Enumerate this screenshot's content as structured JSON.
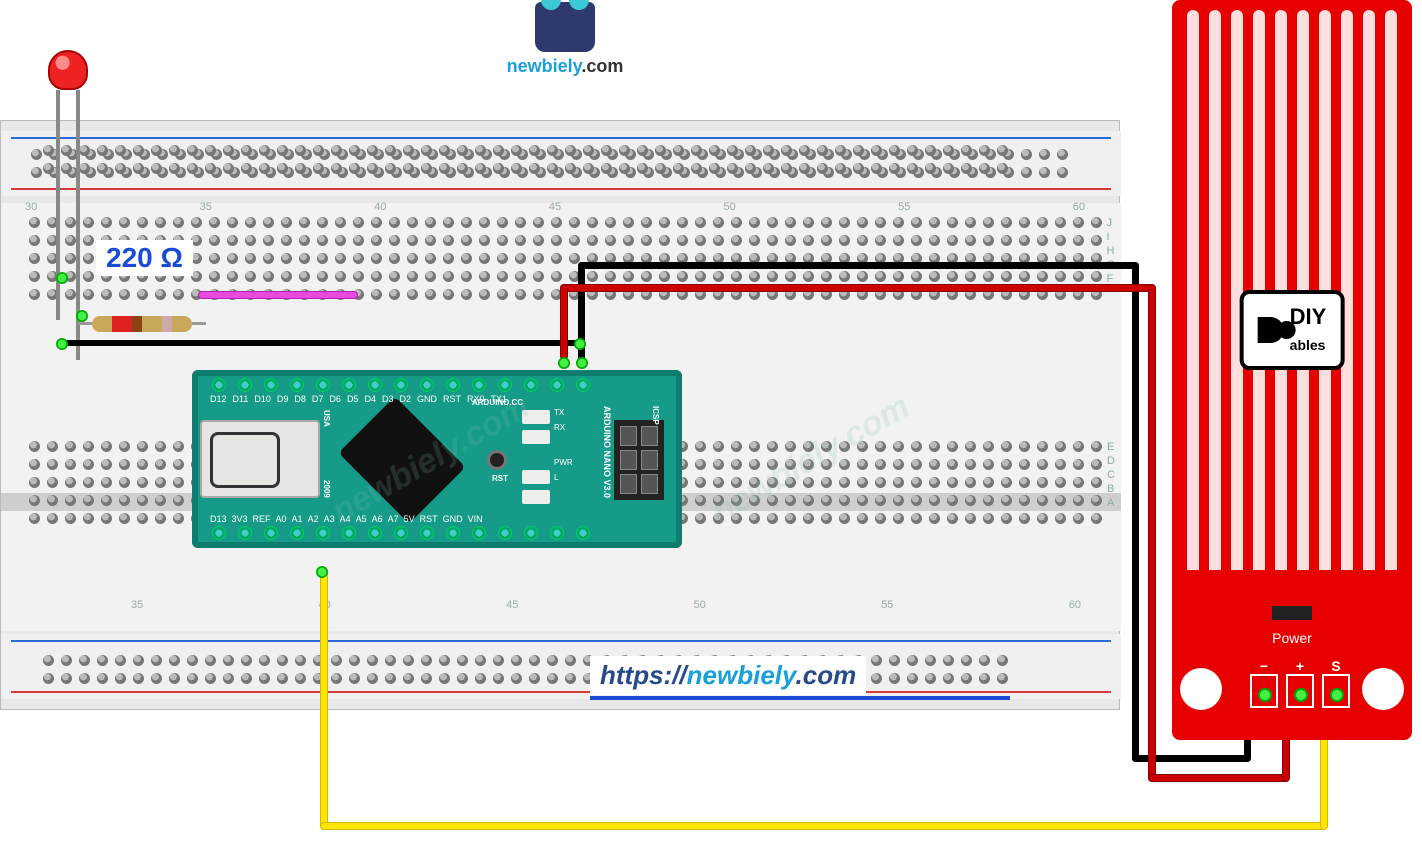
{
  "logo": {
    "text_main": "newbiely",
    "text_tld": ".com"
  },
  "resistor": {
    "label": "220 Ω"
  },
  "link": {
    "prefix": "https://",
    "host": "newbiely",
    "suffix": ".com"
  },
  "breadboard": {
    "col_numbers_top": [
      "30",
      "35",
      "40",
      "45",
      "50",
      "55",
      "60"
    ],
    "col_numbers_mid": [
      "35",
      "40",
      "45",
      "50",
      "55",
      "60"
    ],
    "row_letters_top": [
      "J",
      "I",
      "H",
      "G",
      "F"
    ],
    "row_letters_bot": [
      "E",
      "D",
      "C",
      "B",
      "A"
    ]
  },
  "arduino": {
    "model": "ARDUINO NANO V3.0",
    "cc_label": "ARDUINO.CC",
    "usa_label": "USA",
    "year": "2009",
    "icsp": "ICSP",
    "reset_btn": "RST",
    "top_pins": [
      "D12",
      "D11",
      "D10",
      "D9",
      "D8",
      "D7",
      "D6",
      "D5",
      "D4",
      "D3",
      "D2",
      "GND",
      "RST",
      "RX0",
      "TX1"
    ],
    "bottom_pins": [
      "D13",
      "3V3",
      "REF",
      "A0",
      "A1",
      "A2",
      "A3",
      "A4",
      "A5",
      "A6",
      "A7",
      "5V",
      "RST",
      "GND",
      "VIN"
    ],
    "internal_leds": [
      "TX",
      "RX",
      "PWR",
      "L"
    ]
  },
  "sensor": {
    "brand_text": "DIY",
    "brand_sub": "ables",
    "power_text": "Power",
    "pads": [
      "−",
      "+",
      "S"
    ]
  },
  "components": {
    "led": {
      "color": "red"
    },
    "resistor_value_ohms": 220,
    "jumper_colors": [
      "pink",
      "black",
      "red",
      "yellow"
    ]
  },
  "wire_connections": [
    {
      "color": "black",
      "from": "led-cathode-row",
      "to": "nano-GND-top"
    },
    {
      "color": "pink",
      "from": "resistor-right",
      "to": "nano-D2"
    },
    {
      "color": "black",
      "from": "nano-RX0/TX1-row",
      "to": "sensor-minus"
    },
    {
      "color": "red",
      "from": "nano-adjacent-row",
      "to": "sensor-plus"
    },
    {
      "color": "yellow",
      "from": "nano-A0",
      "to": "sensor-S"
    }
  ],
  "watermark": "newbiely.com"
}
